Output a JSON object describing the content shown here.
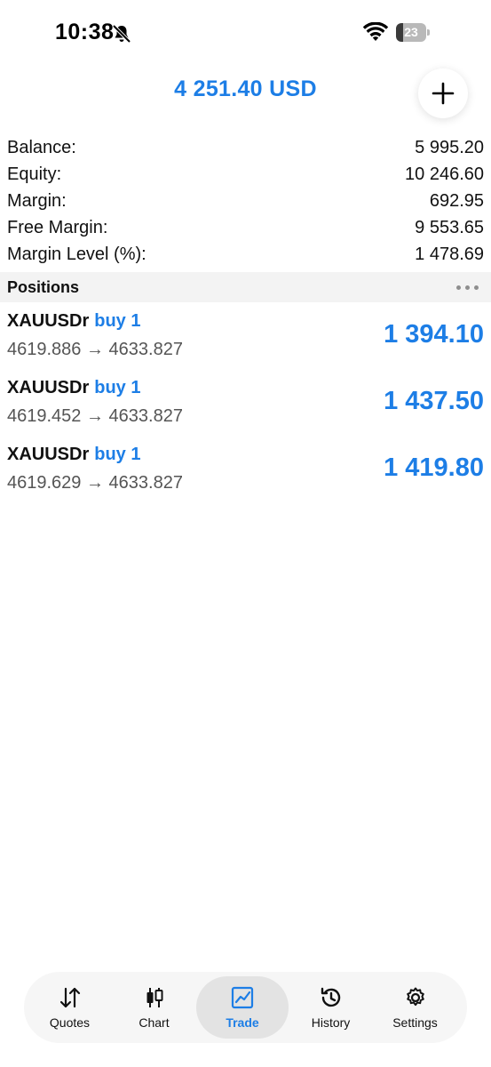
{
  "status_bar": {
    "time": "10:38",
    "battery_level": "23",
    "battery_fraction": 0.23,
    "icons": [
      "bell-slash-icon",
      "wifi-icon",
      "battery-icon"
    ]
  },
  "header": {
    "title": "4 251.40 USD",
    "add_icon": "plus-icon"
  },
  "summary": [
    {
      "label": "Balance:",
      "value": "5 995.20"
    },
    {
      "label": "Equity:",
      "value": "10 246.60"
    },
    {
      "label": "Margin:",
      "value": "692.95"
    },
    {
      "label": "Free Margin:",
      "value": "9 553.65"
    },
    {
      "label": "Margin Level (%):",
      "value": "1 478.69"
    }
  ],
  "positions_section": {
    "title": "Positions",
    "more_icon": "more-horizontal-icon"
  },
  "positions": [
    {
      "symbol": "XAUUSDr",
      "side": "buy 1",
      "prices": "4619.886 → 4633.827",
      "profit": "1 394.10"
    },
    {
      "symbol": "XAUUSDr",
      "side": "buy 1",
      "prices": "4619.452 → 4633.827",
      "profit": "1 437.50"
    },
    {
      "symbol": "XAUUSDr",
      "side": "buy 1",
      "prices": "4619.629 → 4633.827",
      "profit": "1 419.80"
    }
  ],
  "tabs": [
    {
      "label": "Quotes",
      "icon": "arrows-updown-icon",
      "active": false
    },
    {
      "label": "Chart",
      "icon": "candlestick-icon",
      "active": false
    },
    {
      "label": "Trade",
      "icon": "trade-chart-icon",
      "active": true
    },
    {
      "label": "History",
      "icon": "history-clock-icon",
      "active": false
    },
    {
      "label": "Settings",
      "icon": "gear-icon",
      "active": false
    }
  ],
  "colors": {
    "accent": "#1d7ee6",
    "text": "#111111",
    "muted": "#555555",
    "section_bg": "#f3f3f3",
    "tabbar_bg": "#f6f6f6",
    "active_tab_bg": "#e3e3e3"
  }
}
